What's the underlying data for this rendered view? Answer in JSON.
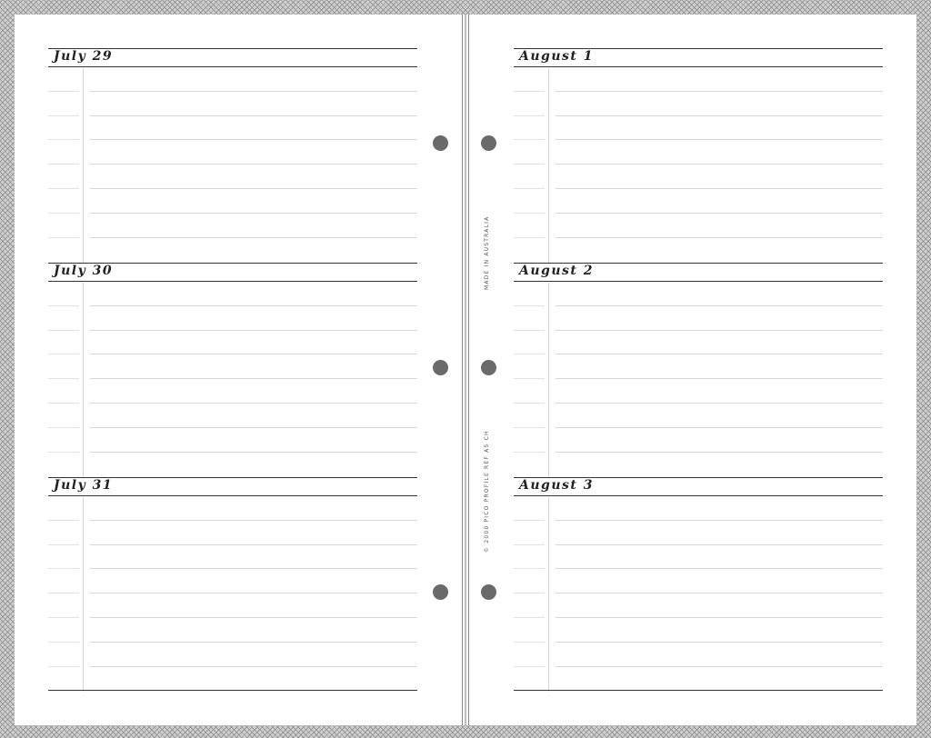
{
  "left_page": {
    "days": [
      {
        "title": "July 29"
      },
      {
        "title": "July 30"
      },
      {
        "title": "July 31"
      }
    ]
  },
  "right_page": {
    "days": [
      {
        "title": "August 1"
      },
      {
        "title": "August 2"
      },
      {
        "title": "August 3"
      }
    ]
  },
  "imprint": {
    "made_in": "MADE  IN  AUSTRALIA",
    "copyright": "© 2000  PICO PROFILE   REF  A5 CH"
  },
  "colors": {
    "border_pattern": "#cfcfcf",
    "rule_dark": "#333333",
    "rule_light": "#d6d6d6",
    "punch_hole": "#6a6a6a"
  }
}
